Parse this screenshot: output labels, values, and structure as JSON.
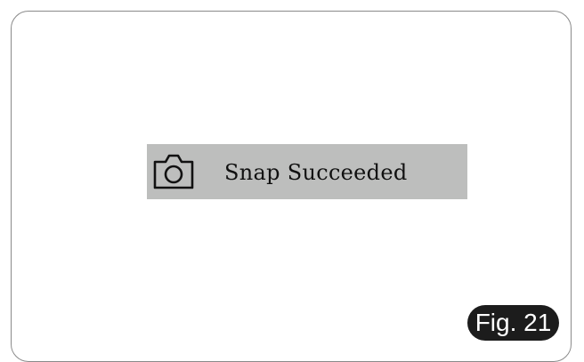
{
  "notification": {
    "icon": "camera-icon",
    "message": "Snap Succeeded",
    "background_color": "#bdbebd"
  },
  "figure_label": "Fig. 21"
}
